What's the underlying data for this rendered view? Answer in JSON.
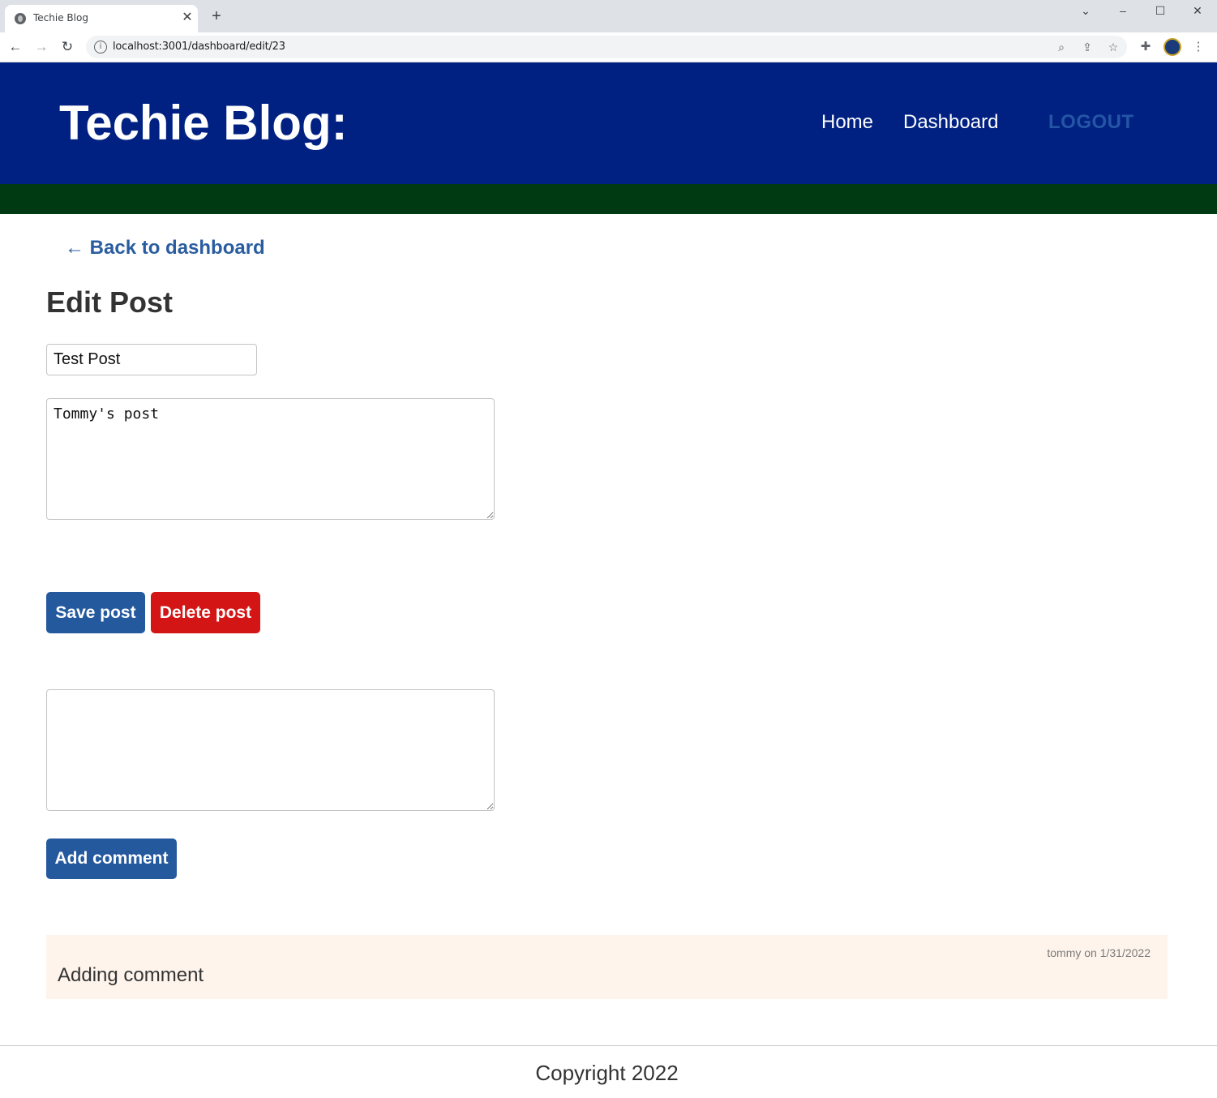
{
  "browser": {
    "tab_title": "Techie Blog",
    "url": "localhost:3001/dashboard/edit/23"
  },
  "header": {
    "site_title": "Techie Blog:",
    "nav": {
      "home": "Home",
      "dashboard": "Dashboard",
      "logout": "LOGOUT"
    }
  },
  "main": {
    "back_link": "← Back to dashboard",
    "heading": "Edit Post",
    "post_title_value": "Test Post",
    "post_content_value": "Tommy's post",
    "comment_value": "",
    "save_label": "Save post",
    "delete_label": "Delete post",
    "add_comment_label": "Add comment"
  },
  "comments": [
    {
      "meta": "tommy on 1/31/2022",
      "text": "Adding comment"
    }
  ],
  "footer": {
    "copyright": "Copyright 2022"
  },
  "colors": {
    "header_bg": "#002182",
    "green_bar": "#003a12",
    "primary_button": "#24599e",
    "danger_button": "#d41515",
    "comment_bg": "#fef4ec"
  }
}
